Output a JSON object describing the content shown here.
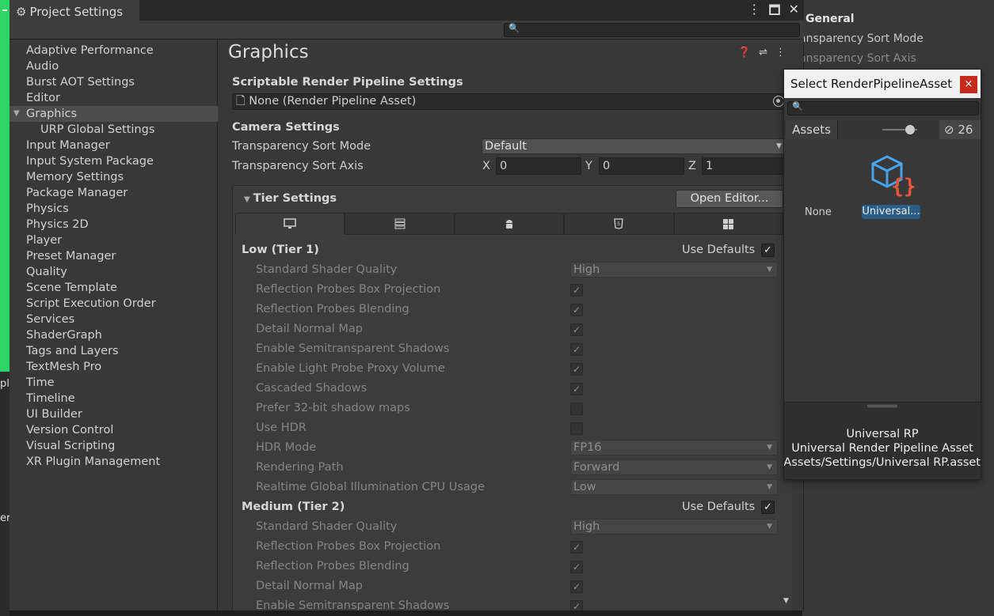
{
  "window": {
    "title": "Project Settings"
  },
  "background_editor": {
    "header": "General",
    "row1": "ansparency Sort Mode",
    "row2": "ansparency Sort Axis"
  },
  "left_edge": {
    "frag1": "pl",
    "frag2": "er"
  },
  "sidebar": {
    "items": [
      {
        "label": "Adaptive Performance"
      },
      {
        "label": "Audio"
      },
      {
        "label": "Burst AOT Settings"
      },
      {
        "label": "Editor"
      },
      {
        "label": "Graphics"
      },
      {
        "label": "URP Global Settings"
      },
      {
        "label": "Input Manager"
      },
      {
        "label": "Input System Package"
      },
      {
        "label": "Memory Settings"
      },
      {
        "label": "Package Manager"
      },
      {
        "label": "Physics"
      },
      {
        "label": "Physics 2D"
      },
      {
        "label": "Player"
      },
      {
        "label": "Preset Manager"
      },
      {
        "label": "Quality"
      },
      {
        "label": "Scene Template"
      },
      {
        "label": "Script Execution Order"
      },
      {
        "label": "Services"
      },
      {
        "label": "ShaderGraph"
      },
      {
        "label": "Tags and Layers"
      },
      {
        "label": "TextMesh Pro"
      },
      {
        "label": "Time"
      },
      {
        "label": "Timeline"
      },
      {
        "label": "UI Builder"
      },
      {
        "label": "Version Control"
      },
      {
        "label": "Visual Scripting"
      },
      {
        "label": "XR Plugin Management"
      }
    ],
    "selected": "Graphics"
  },
  "graphics": {
    "title": "Graphics",
    "srp_section": "Scriptable Render Pipeline Settings",
    "srp_value": "None (Render Pipeline Asset)",
    "camera_section": "Camera Settings",
    "sort_mode_label": "Transparency Sort Mode",
    "sort_mode_value": "Default",
    "sort_axis_label": "Transparency Sort Axis",
    "axis": {
      "x_label": "X",
      "x": "0",
      "y_label": "Y",
      "y": "0",
      "z_label": "Z",
      "z": "1"
    },
    "tier_settings": {
      "title": "Tier Settings",
      "open_editor": "Open Editor...",
      "platform_tabs": [
        "desktop-icon",
        "server-icon",
        "android-icon",
        "html5-icon",
        "windows-icon"
      ],
      "use_defaults": "Use Defaults",
      "tier1": {
        "name": "Low (Tier 1)",
        "shader_quality_label": "Standard Shader Quality",
        "shader_quality": "High",
        "rows": [
          {
            "label": "Reflection Probes Box Projection",
            "checked": true
          },
          {
            "label": "Reflection Probes Blending",
            "checked": true
          },
          {
            "label": "Detail Normal Map",
            "checked": true
          },
          {
            "label": "Enable Semitransparent Shadows",
            "checked": true
          },
          {
            "label": "Enable Light Probe Proxy Volume",
            "checked": true
          },
          {
            "label": "Cascaded Shadows",
            "checked": true
          },
          {
            "label": "Prefer 32-bit shadow maps",
            "checked": false
          },
          {
            "label": "Use HDR",
            "checked": false
          }
        ],
        "hdr_mode_label": "HDR Mode",
        "hdr_mode": "FP16",
        "render_path_label": "Rendering Path",
        "render_path": "Forward",
        "gi_label": "Realtime Global Illumination CPU Usage",
        "gi": "Low"
      },
      "tier2": {
        "name": "Medium (Tier 2)",
        "shader_quality_label": "Standard Shader Quality",
        "shader_quality": "High",
        "rows": [
          {
            "label": "Reflection Probes Box Projection",
            "checked": true
          },
          {
            "label": "Reflection Probes Blending",
            "checked": true
          },
          {
            "label": "Detail Normal Map",
            "checked": true
          },
          {
            "label": "Enable Semitransparent Shadows",
            "checked": true
          }
        ]
      }
    }
  },
  "picker": {
    "title": "Select RenderPipelineAsset",
    "close": "×",
    "tab": "Assets",
    "hidden_count": "26",
    "item_none": "None",
    "item_urp": "Universal...",
    "info_name": "Universal RP",
    "info_type": "Universal Render Pipeline Asset",
    "info_path": "Assets/Settings/Universal RP.asset"
  },
  "colors": {
    "accent_green": "#2fd564",
    "selection_blue": "#2c5d87",
    "close_red": "#c42b1c",
    "icon_blue": "#4aa3e8",
    "icon_orange": "#e8553a"
  }
}
